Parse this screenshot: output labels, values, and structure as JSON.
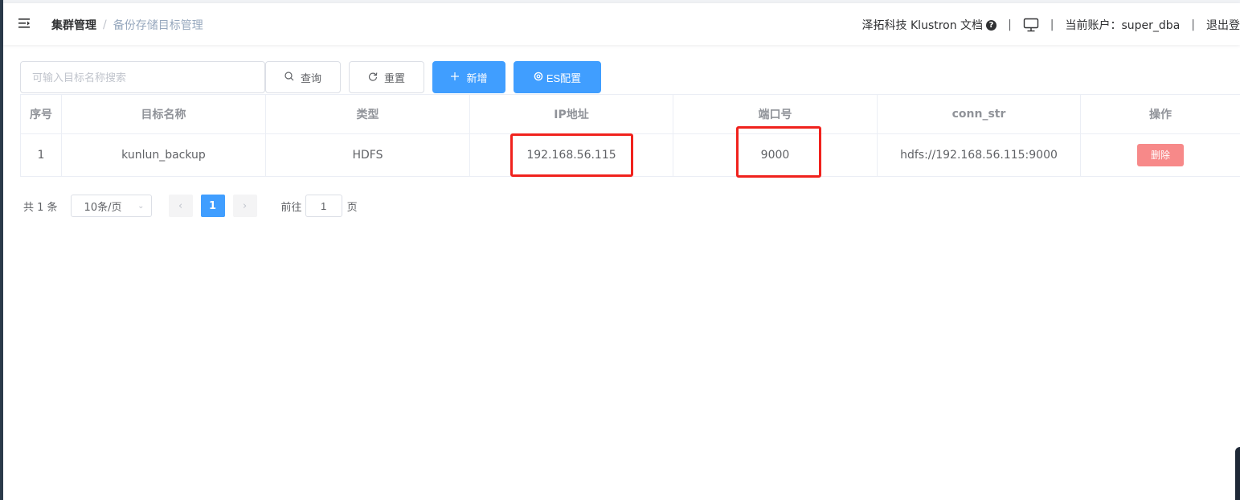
{
  "header": {
    "breadcrumb": [
      "集群管理",
      "备份存储目标管理"
    ],
    "breadcrumb_separator": "/",
    "brand_docs": "泽拓科技 Klustron 文档",
    "help_icon": "?",
    "account_label": "当前账户：super_dba",
    "logout": "退出登",
    "separator": "|"
  },
  "toolbar": {
    "search_placeholder": "可输入目标名称搜索",
    "query_label": "查询",
    "reset_label": "重置",
    "add_label": "新增",
    "es_label": "ES配置",
    "query_icon": "search-icon",
    "reset_icon": "refresh-icon",
    "add_icon": "plus-icon",
    "es_icon": "settings-icon"
  },
  "table": {
    "columns": [
      "序号",
      "目标名称",
      "类型",
      "IP地址",
      "端口号",
      "conn_str",
      "操作"
    ],
    "rows": [
      {
        "index": "1",
        "name": "kunlun_backup",
        "type": "HDFS",
        "ip": "192.168.56.115",
        "port": "9000",
        "conn_str": "hdfs://192.168.56.115:9000",
        "action": "删除"
      }
    ]
  },
  "pagination": {
    "total": "共 1 条",
    "page_size": "10条/页",
    "current_page": "1",
    "goto_label": "前往",
    "goto_value": "1",
    "page_suffix": "页"
  },
  "colors": {
    "primary": "#409eff",
    "danger": "#f78989",
    "highlight": "#f0221d"
  }
}
